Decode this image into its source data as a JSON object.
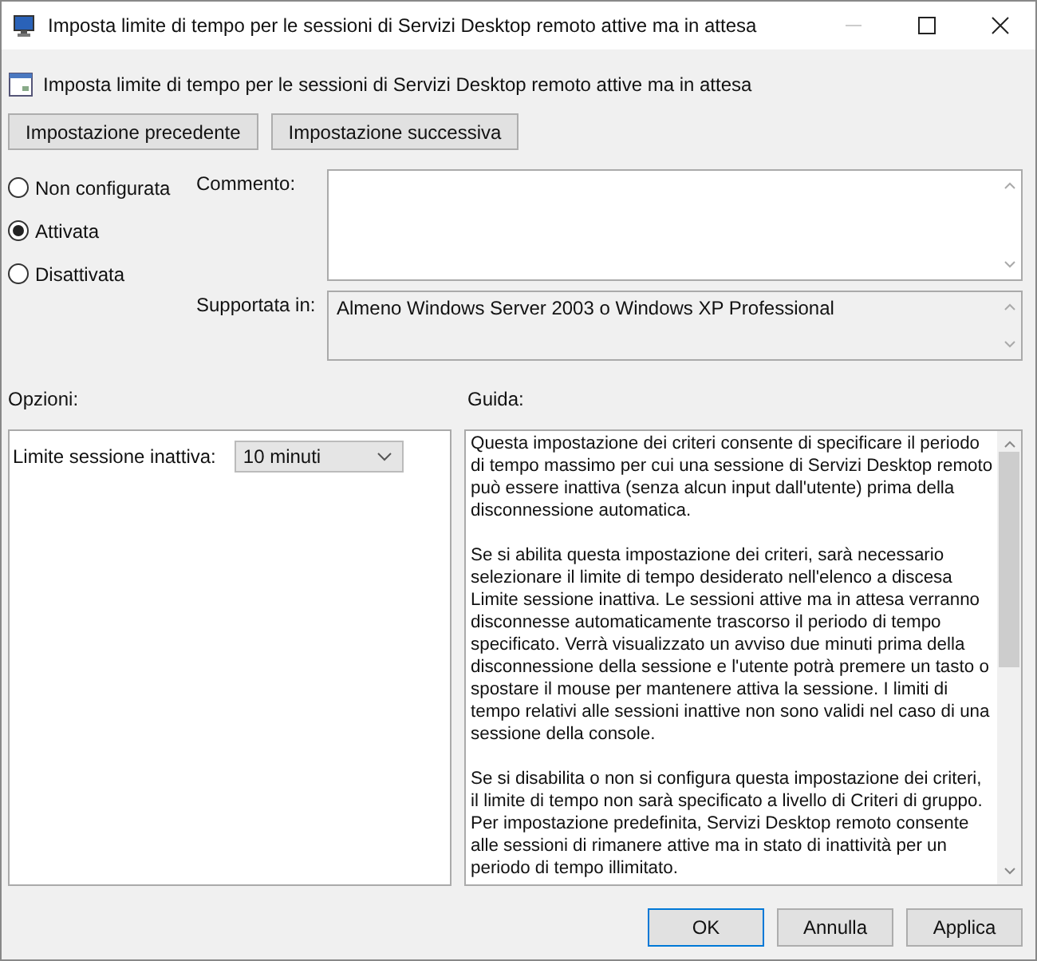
{
  "window": {
    "title": "Imposta limite di tempo per le sessioni di Servizi Desktop remoto attive ma in attesa"
  },
  "header": {
    "title": "Imposta limite di tempo per le sessioni di Servizi Desktop remoto attive ma in attesa"
  },
  "nav_buttons": [
    "Impostazione precedente",
    "Impostazione successiva"
  ],
  "states": [
    {
      "label": "Non configurata",
      "selected": false
    },
    {
      "label": "Attivata",
      "selected": true
    },
    {
      "label": "Disattivata",
      "selected": false
    }
  ],
  "comment": {
    "label": "Commento:"
  },
  "supported": {
    "label": "Supportata in:",
    "value": "Almeno Windows Server 2003 o Windows XP Professional"
  },
  "options": {
    "heading": "Opzioni:",
    "fields": [
      {
        "label": "Limite sessione inattiva:",
        "value": "10 minuti"
      }
    ]
  },
  "help": {
    "heading": "Guida:",
    "paragraphs": [
      "Questa impostazione dei criteri consente di specificare il periodo di tempo massimo per cui una sessione di Servizi Desktop remoto può essere inattiva (senza alcun input dall'utente) prima della disconnessione automatica.",
      "Se si abilita questa impostazione dei criteri, sarà necessario selezionare il limite di tempo desiderato nell'elenco a discesa Limite sessione inattiva. Le sessioni attive ma in attesa verranno disconnesse automaticamente trascorso il periodo di tempo specificato. Verrà visualizzato un avviso due minuti prima della disconnessione della sessione e l'utente potrà premere un tasto o spostare il mouse per mantenere attiva la sessione. I limiti di tempo relativi alle sessioni inattive non sono validi nel caso di una sessione della console.",
      "Se si disabilita o non si configura questa impostazione dei criteri, il limite di tempo non sarà specificato a livello di Criteri di gruppo. Per impostazione predefinita, Servizi Desktop remoto consente alle sessioni di rimanere attive ma in stato di inattività per un periodo di tempo illimitato."
    ]
  },
  "footer_buttons": [
    "OK",
    "Annulla",
    "Applica"
  ]
}
